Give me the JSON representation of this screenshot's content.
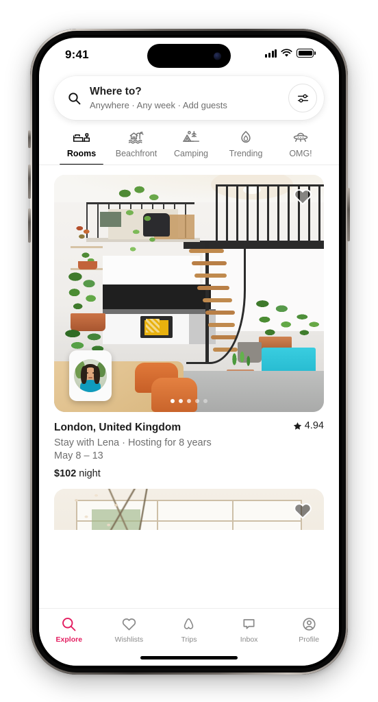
{
  "status_bar": {
    "time": "9:41",
    "signal_icon": "cellular-bars-icon",
    "wifi_icon": "wifi-icon",
    "battery_icon": "battery-full-icon"
  },
  "search": {
    "icon": "search-icon",
    "title": "Where to?",
    "subtitle": "Anywhere · Any week · Add guests",
    "filter_icon": "filter-sliders-icon"
  },
  "categories": [
    {
      "label": "Rooms",
      "icon": "bed-room-icon",
      "active": true
    },
    {
      "label": "Beachfront",
      "icon": "beach-hut-icon",
      "active": false
    },
    {
      "label": "Camping",
      "icon": "tent-camping-icon",
      "active": false
    },
    {
      "label": "Trending",
      "icon": "flame-trending-icon",
      "active": false
    },
    {
      "label": "OMG!",
      "icon": "ufo-omg-icon",
      "active": false
    }
  ],
  "listings": [
    {
      "place": "London, United Kingdom",
      "rating": "4.94",
      "star_icon": "star-icon",
      "host_line": "Stay with Lena · Hosting for 8 years",
      "dates": "May 8 – 13",
      "price_amount": "$102",
      "price_unit": "night",
      "save_icon": "heart-icon",
      "photo_count_dots": 5,
      "active_dot": 1,
      "host_avatar": "host-avatar"
    },
    {
      "save_icon": "heart-icon"
    }
  ],
  "tabs": [
    {
      "label": "Explore",
      "icon": "search-icon",
      "active": true
    },
    {
      "label": "Wishlists",
      "icon": "heart-outline-icon",
      "active": false
    },
    {
      "label": "Trips",
      "icon": "airbnb-belo-icon",
      "active": false
    },
    {
      "label": "Inbox",
      "icon": "message-bubble-icon",
      "active": false
    },
    {
      "label": "Profile",
      "icon": "user-circle-icon",
      "active": false
    }
  ],
  "colors": {
    "accent": "#E31C5F",
    "text": "#1c1c1c",
    "muted": "#6f6f6f"
  }
}
